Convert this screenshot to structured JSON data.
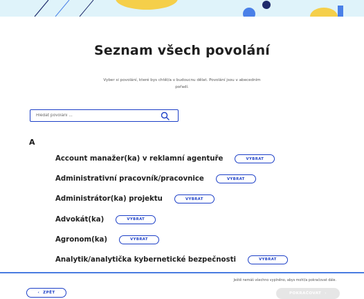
{
  "header": {
    "title": "Seznam všech povolání",
    "subtitle": "Vyber si povolání, které bys chtěl/a v budoucnu dělat. Povolání jsou v abecedním pořadí."
  },
  "search": {
    "placeholder": "Hledat povolání ...",
    "value": "",
    "icon": "search-icon"
  },
  "section": {
    "letter": "A"
  },
  "jobs": [
    {
      "name": "Account manažer(ka) v reklamní agentuře",
      "button": "VYBRAT"
    },
    {
      "name": "Administrativní pracovník/pracovnice",
      "button": "VYBRAT"
    },
    {
      "name": "Administrátor(ka) projektu",
      "button": "VYBRAT"
    },
    {
      "name": "Advokát(ka)",
      "button": "VYBRAT"
    },
    {
      "name": "Agronom(ka)",
      "button": "VYBRAT"
    },
    {
      "name": "Analytik/analytička kybernetické bezpečnosti",
      "button": "VYBRAT"
    }
  ],
  "footer": {
    "note": "Ještě nemáš všechno vyplněno, abys mohl/a pokračovat dále.",
    "back_label": "ZPĚT",
    "back_chevron": "‹",
    "continue_label": "POKRAČOVAT",
    "continue_chevron": "›",
    "continue_enabled": false
  },
  "colors": {
    "accent": "#1c3fc7",
    "footer_line": "#4a7ce0",
    "hero_bg": "#dff3fa",
    "deco_yellow": "#f5cf4a",
    "deco_navy": "#1e2a6b",
    "deco_blue": "#4a80e8"
  }
}
